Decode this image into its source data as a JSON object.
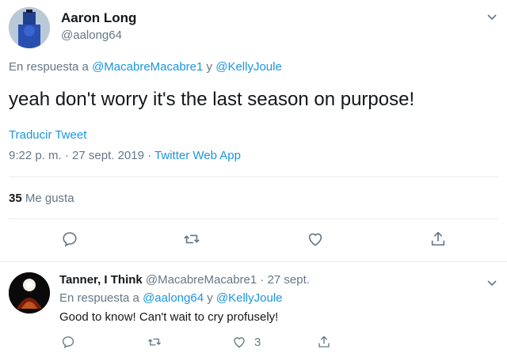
{
  "main_tweet": {
    "author_name": "Aaron Long",
    "author_handle": "@aalong64",
    "reply_prefix": "En respuesta a",
    "reply_user_1": "@MacabreMacabre1",
    "reply_conj": "y",
    "reply_user_2": "@KellyJoule",
    "text": "yeah don't worry it's the last season on purpose!",
    "translate_label": "Traducir Tweet",
    "time": "9:22 p. m.",
    "date": "27 sept. 2019",
    "client": "Twitter Web App",
    "likes_count": "35",
    "likes_label": "Me gusta"
  },
  "reply_tweet": {
    "author_name": "Tanner, I Think",
    "author_handle": "@MacabreMacabre1",
    "date": "27 sept.",
    "reply_prefix": "En respuesta a",
    "reply_user_1": "@aalong64",
    "reply_conj": "y",
    "reply_user_2": "@KellyJoule",
    "text": "Good to know! Can't wait to cry profusely!",
    "like_count": "3"
  },
  "icons": {
    "reply": "reply-icon",
    "retweet": "retweet-icon",
    "like": "heart-icon",
    "share": "share-icon",
    "more": "chevron-down-icon"
  },
  "colors": {
    "link": "#1b95e0",
    "secondary_text": "#657786",
    "primary_text": "#14171a",
    "divider": "#e6ecf0"
  }
}
